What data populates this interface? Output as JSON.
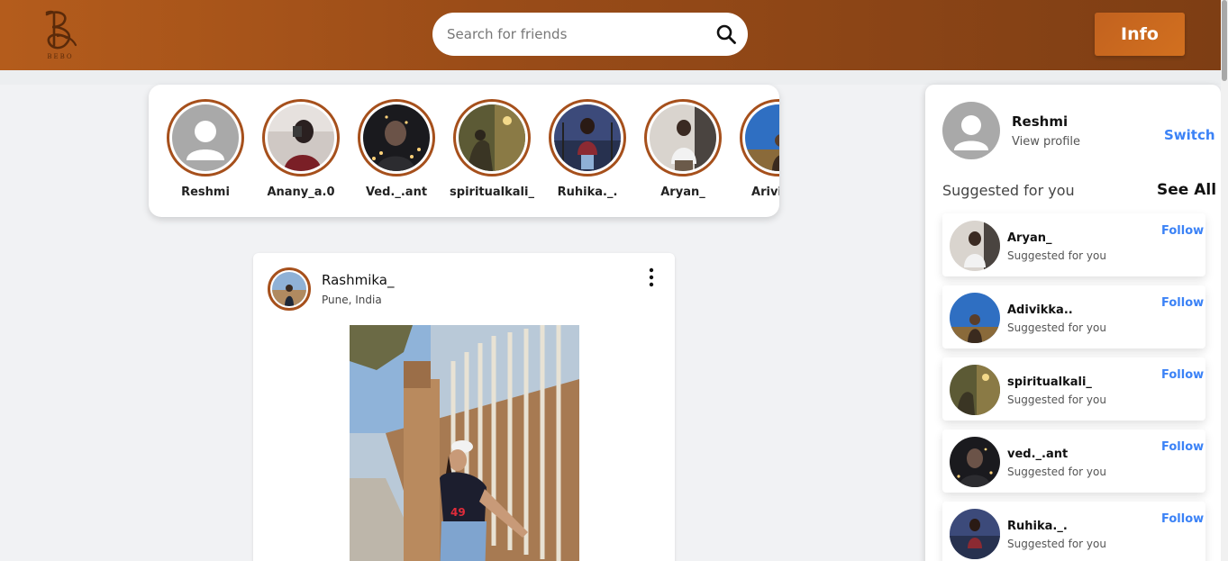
{
  "header": {
    "logo_text": "BEBO",
    "search_placeholder": "Search for friends",
    "info_label": "Info"
  },
  "stories": [
    {
      "name": "Reshmi",
      "avatar": "default"
    },
    {
      "name": "Anany_a.0",
      "avatar": "photo"
    },
    {
      "name": "Ved._.ant",
      "avatar": "photo"
    },
    {
      "name": "spiritualkali_",
      "avatar": "photo"
    },
    {
      "name": "Ruhika._.",
      "avatar": "photo"
    },
    {
      "name": "Aryan_",
      "avatar": "photo"
    },
    {
      "name": "Arivikka",
      "avatar": "photo"
    }
  ],
  "post": {
    "username": "Rashmika_",
    "location": "Pune, India",
    "menu_icon": "more-vertical-icon"
  },
  "sidebar": {
    "profile_name": "Reshmi",
    "view_profile": "View profile",
    "switch_label": "Switch",
    "suggested_title": "Suggested for you",
    "see_all": "See All",
    "suggestions": [
      {
        "name": "Aryan_",
        "sub": "Suggested for you",
        "action": "Follow"
      },
      {
        "name": "Adivikka..",
        "sub": "Suggested for you",
        "action": "Follow"
      },
      {
        "name": "spiritualkali_",
        "sub": "Suggested for you",
        "action": "Follow"
      },
      {
        "name": "ved._.ant",
        "sub": "Suggested for you",
        "action": "Follow"
      },
      {
        "name": "Ruhika._.",
        "sub": "Suggested for you",
        "action": "Follow"
      }
    ]
  },
  "colors": {
    "header_start": "#b45c1c",
    "header_end": "#7e3e14",
    "accent_link": "#3b82f6",
    "story_ring": "#a6501c"
  }
}
